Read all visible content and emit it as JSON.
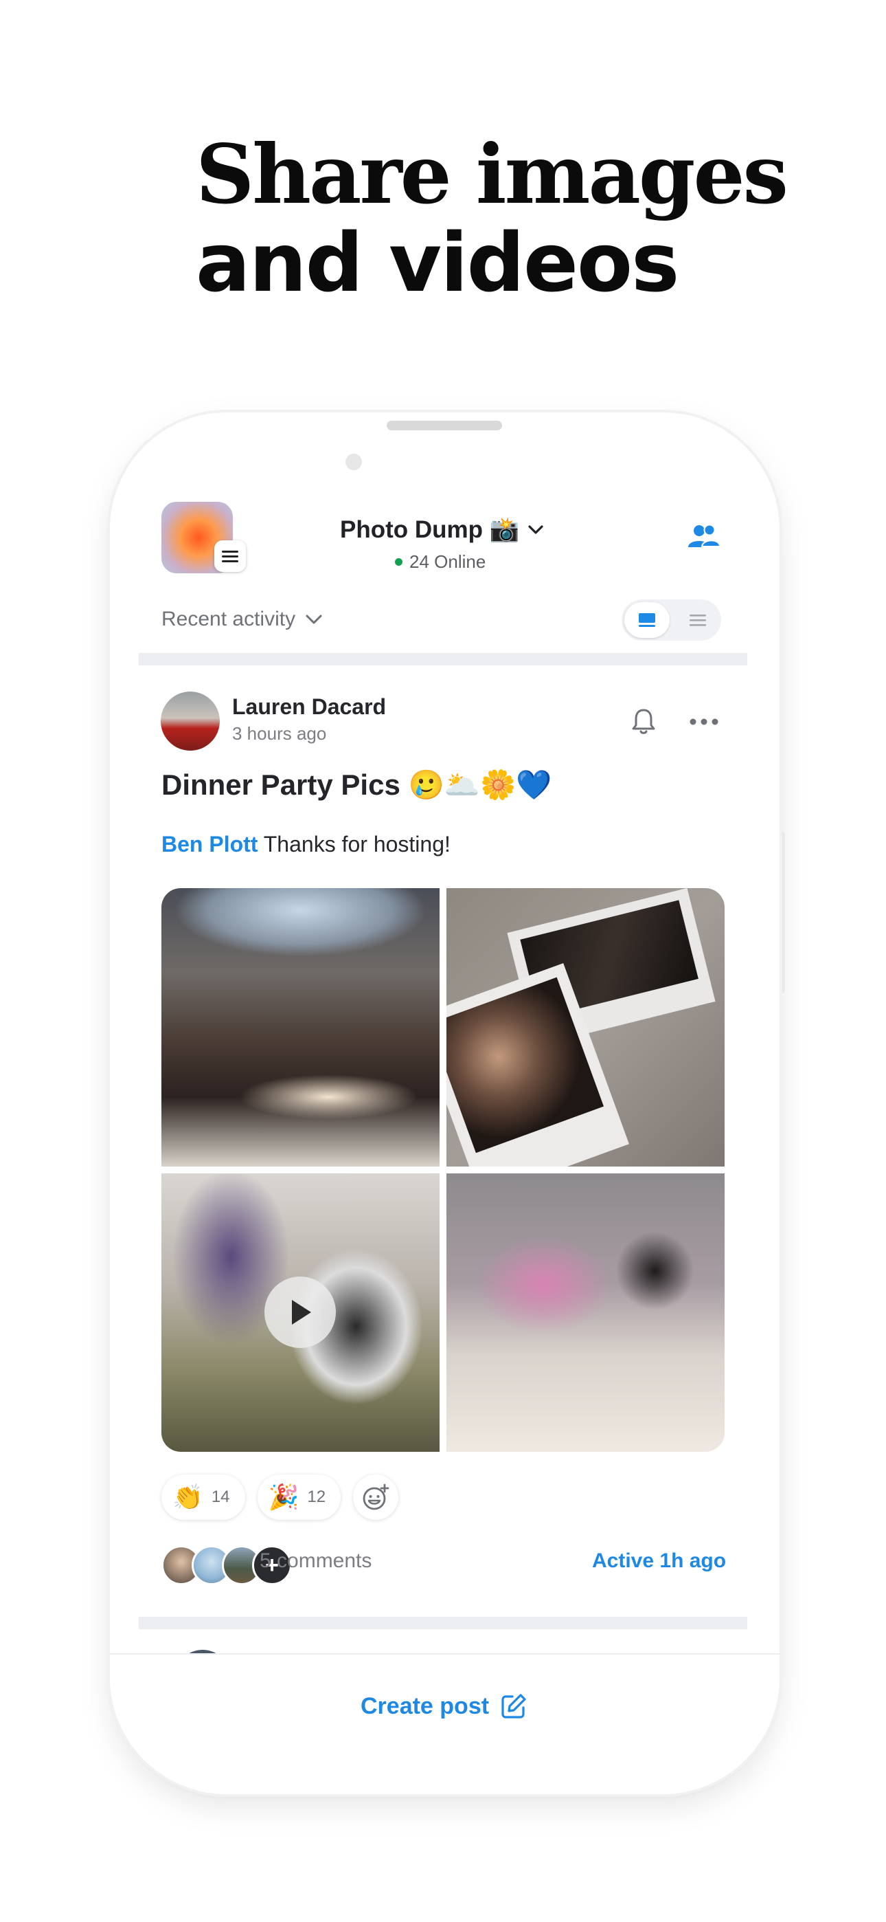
{
  "headline": {
    "line1": "Share images",
    "line2": "and videos"
  },
  "header": {
    "channel_name": "Photo Dump 📸",
    "online_status": "24 Online",
    "menu_icon": "hamburger-icon",
    "members_icon": "users-icon",
    "accent_color": "#1e88e5"
  },
  "filter": {
    "label": "Recent activity",
    "view_modes": [
      "card-view-icon",
      "list-view-icon"
    ],
    "selected_view": "card-view-icon"
  },
  "post": {
    "author": "Lauren Dacard",
    "time": "3 hours ago",
    "title": "Dinner Party Pics 🥲🌥️🌼💙",
    "mention": "Ben Plott",
    "body": " Thanks for hosting!",
    "media_count": 4,
    "video_icon": "play-icon",
    "reactions": [
      {
        "emoji": "👏",
        "count": "14"
      },
      {
        "emoji": "🎉",
        "count": "12"
      }
    ],
    "comments": "5 comments",
    "activity": "Active 1h ago"
  },
  "footer": {
    "create_post_label": "Create post",
    "create_post_icon": "edit-icon"
  }
}
